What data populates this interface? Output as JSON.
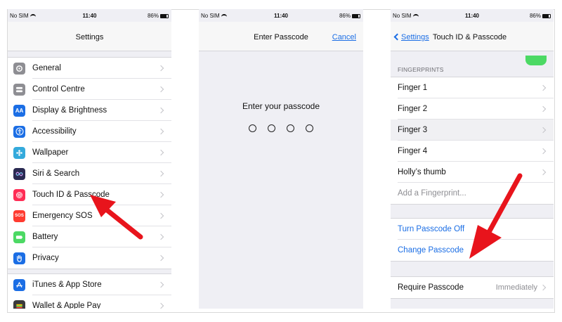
{
  "status": {
    "carrier": "No SIM",
    "time": "11:40",
    "battery": "86%"
  },
  "panel1": {
    "title": "Settings",
    "rows": [
      {
        "label": "General",
        "icon": "gear-icon"
      },
      {
        "label": "Control Centre",
        "icon": "switches-icon"
      },
      {
        "label": "Display & Brightness",
        "icon": "aa-icon",
        "icon_text": "AA"
      },
      {
        "label": "Accessibility",
        "icon": "accessibility-icon"
      },
      {
        "label": "Wallpaper",
        "icon": "flower-icon"
      },
      {
        "label": "Siri & Search",
        "icon": "siri-icon"
      },
      {
        "label": "Touch ID & Passcode",
        "icon": "fingerprint-icon"
      },
      {
        "label": "Emergency SOS",
        "icon": "sos-icon",
        "icon_text": "SOS"
      },
      {
        "label": "Battery",
        "icon": "battery-icon"
      },
      {
        "label": "Privacy",
        "icon": "hand-icon"
      }
    ],
    "rows2": [
      {
        "label": "iTunes & App Store",
        "icon": "app-store-icon"
      },
      {
        "label": "Wallet & Apple Pay",
        "icon": "wallet-icon"
      }
    ]
  },
  "panel2": {
    "title": "Enter Passcode",
    "cancel": "Cancel",
    "prompt": "Enter your passcode"
  },
  "panel3": {
    "back": "Settings",
    "title": "Touch ID & Passcode",
    "section": "FINGERPRINTS",
    "fingers": [
      "Finger 1",
      "Finger 2",
      "Finger 3",
      "Finger 4",
      "Holly’s thumb"
    ],
    "add": "Add a Fingerprint...",
    "turn_off": "Turn Passcode Off",
    "change": "Change Passcode",
    "require_label": "Require Passcode",
    "require_value": "Immediately"
  },
  "colors": {
    "accent": "#1b6ee5",
    "arrow": "#e8141c",
    "toggle_on": "#4cd964"
  }
}
